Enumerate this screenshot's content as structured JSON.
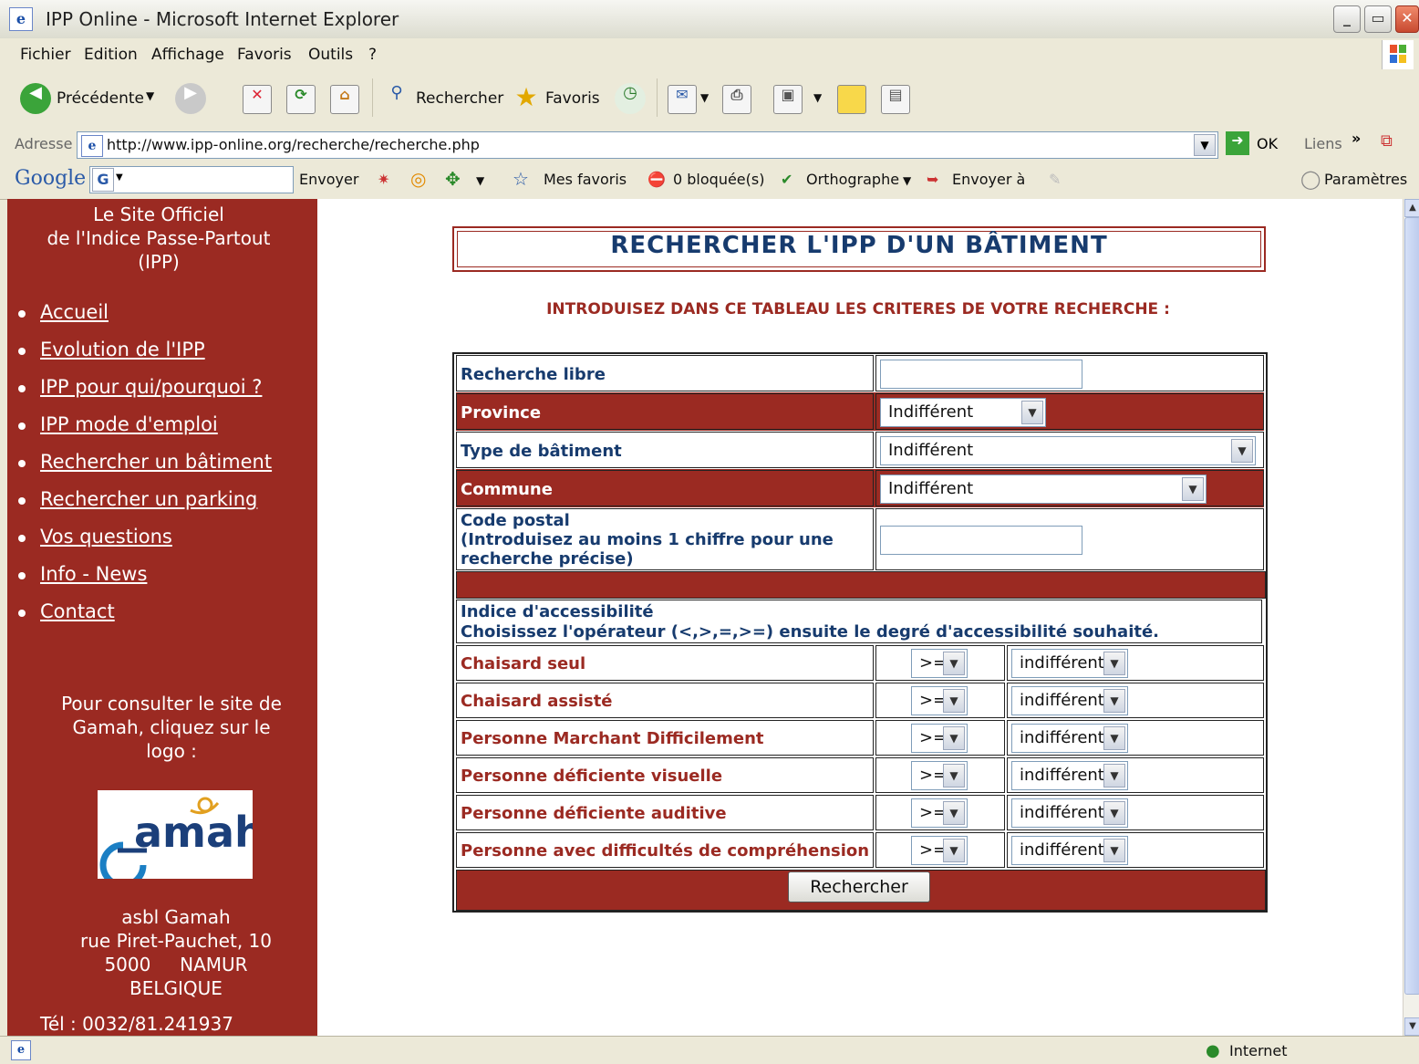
{
  "window": {
    "title": "IPP Online - Microsoft Internet Explorer",
    "minimize": "_",
    "maximize": "▭",
    "close": "✕"
  },
  "menu": [
    "Fichier",
    "Edition",
    "Affichage",
    "Favoris",
    "Outils",
    "?"
  ],
  "toolbar": {
    "back": "Précédente",
    "search": "Rechercher",
    "favorites": "Favoris"
  },
  "address": {
    "label": "Adresse",
    "url": "http://www.ipp-online.org/recherche/recherche.php",
    "go": "OK",
    "links": "Liens",
    "more": "»"
  },
  "googlebar": {
    "logo": "Google",
    "send": "Envoyer",
    "my_favorites": "Mes favoris",
    "blocked": "0 bloquée(s)",
    "spelling": "Orthographe",
    "send_to": "Envoyer à",
    "settings": "Paramètres"
  },
  "sidebar": {
    "title_lines": [
      "Le Site Officiel",
      "de l'Indice Passe-Partout",
      "(IPP)"
    ],
    "nav": [
      "Accueil",
      "Evolution de l'IPP",
      "IPP pour qui/pourquoi ?",
      "IPP mode d'emploi",
      "Rechercher un bâtiment",
      "Rechercher un parking",
      "Vos questions",
      "Info - News",
      "Contact"
    ],
    "consult_lines": [
      "Pour consulter le site de",
      "Gamah, cliquez sur le",
      "logo :"
    ],
    "logo_text": "Gamah",
    "address_lines": [
      "asbl Gamah",
      "rue Piret-Pauchet, 10",
      "5000     NAMUR",
      "BELGIQUE"
    ],
    "tel": "Tél : 0032/81.241937"
  },
  "main": {
    "heading": "RECHERCHER L'IPP D'UN BÂTIMENT",
    "intro": "INTRODUISEZ DANS CE TABLEAU LES CRITERES DE VOTRE RECHERCHE :",
    "fields": {
      "free_search": {
        "label": "Recherche libre",
        "value": ""
      },
      "province": {
        "label": "Province",
        "value": "Indifférent"
      },
      "building_type": {
        "label": "Type de bâtiment",
        "value": "Indifférent"
      },
      "commune": {
        "label": "Commune",
        "value": "Indifférent"
      },
      "postal": {
        "label_lines": [
          "Code postal",
          "(Introduisez au moins 1 chiffre pour une",
          "recherche précise)"
        ],
        "value": ""
      }
    },
    "accessibility": {
      "title": "Indice d'accessibilité",
      "subtitle": "Choisissez l'opérateur (<,>,=,>=) ensuite le degré d'accessibilité souhaité.",
      "criteria": [
        {
          "label": "Chaisard seul",
          "operator": ">=",
          "level": "indifférent"
        },
        {
          "label": "Chaisard assisté",
          "operator": ">=",
          "level": "indifférent"
        },
        {
          "label": "Personne Marchant Difficilement",
          "operator": ">=",
          "level": "indifférent"
        },
        {
          "label": "Personne déficiente visuelle",
          "operator": ">=",
          "level": "indifférent"
        },
        {
          "label": "Personne déficiente auditive",
          "operator": ">=",
          "level": "indifférent"
        },
        {
          "label": "Personne avec difficultés de compréhension",
          "operator": ">=",
          "level": "indifférent"
        }
      ]
    },
    "search_button": "Rechercher"
  },
  "status": {
    "zone": "Internet"
  }
}
